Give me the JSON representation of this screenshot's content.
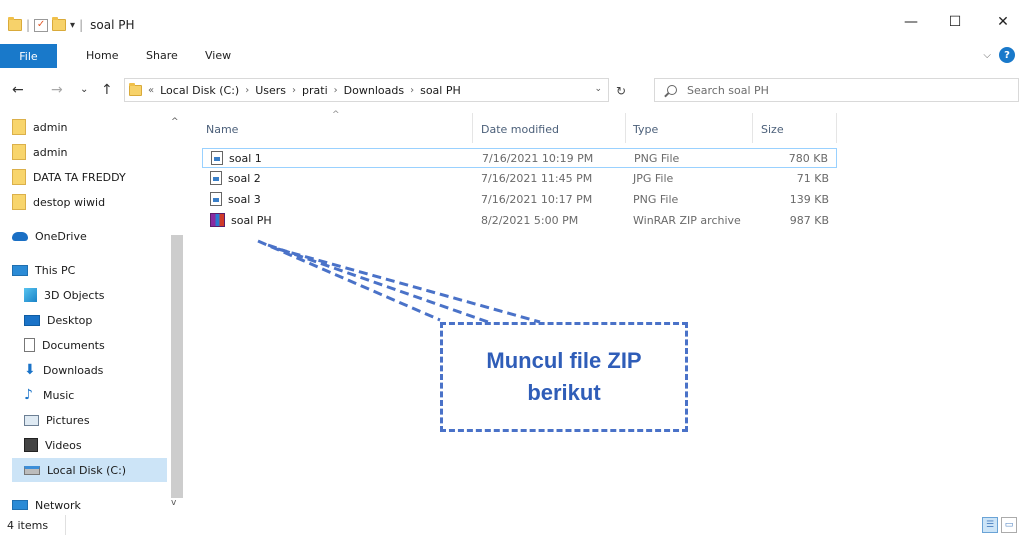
{
  "window": {
    "title": "soal PH",
    "controls": {
      "minimize": "—",
      "maximize": "☐",
      "close": "✕"
    }
  },
  "ribbon": {
    "tabs": [
      "File",
      "Home",
      "Share",
      "View"
    ],
    "help": "?",
    "expand": "⌵"
  },
  "nav": {
    "back": "←",
    "forward": "→",
    "recent": "⌄",
    "up": "↑"
  },
  "address": {
    "overflow": "«",
    "crumbs": [
      "Local Disk (C:)",
      "Users",
      "prati",
      "Downloads",
      "soal PH"
    ],
    "sep": "›",
    "dropdown": "⌄",
    "refresh": "↻"
  },
  "search": {
    "placeholder": "Search soal PH"
  },
  "sidebar": {
    "items": [
      {
        "label": "admin",
        "icon": "folder-icon"
      },
      {
        "label": "admin",
        "icon": "folder-icon"
      },
      {
        "label": "DATA TA FREDDY",
        "icon": "folder-icon"
      },
      {
        "label": "destop wiwid",
        "icon": "folder-icon"
      },
      {
        "label": "OneDrive",
        "icon": "cloud-icon"
      },
      {
        "label": "This PC",
        "icon": "computer-icon"
      },
      {
        "label": "3D Objects",
        "icon": "cube-icon"
      },
      {
        "label": "Desktop",
        "icon": "desktop-icon"
      },
      {
        "label": "Documents",
        "icon": "document-icon"
      },
      {
        "label": "Downloads",
        "icon": "download-icon"
      },
      {
        "label": "Music",
        "icon": "music-icon"
      },
      {
        "label": "Pictures",
        "icon": "picture-icon"
      },
      {
        "label": "Videos",
        "icon": "video-icon"
      },
      {
        "label": "Local Disk (C:)",
        "icon": "disk-icon",
        "selected": true
      },
      {
        "label": "Network",
        "icon": "network-icon"
      }
    ],
    "scroll_up": "^",
    "scroll_down": "v"
  },
  "files": {
    "columns": {
      "name": "Name",
      "date": "Date modified",
      "type": "Type",
      "size": "Size"
    },
    "sort_indicator": "^",
    "rows": [
      {
        "name": "soal 1",
        "date": "7/16/2021 10:19 PM",
        "type": "PNG File",
        "size": "780 KB",
        "icon": "image-file-icon"
      },
      {
        "name": "soal 2",
        "date": "7/16/2021 11:45 PM",
        "type": "JPG File",
        "size": "71 KB",
        "icon": "image-file-icon"
      },
      {
        "name": "soal 3",
        "date": "7/16/2021 10:17 PM",
        "type": "PNG File",
        "size": "139 KB",
        "icon": "image-file-icon"
      },
      {
        "name": "soal PH",
        "date": "8/2/2021 5:00 PM",
        "type": "WinRAR ZIP archive",
        "size": "987 KB",
        "icon": "winrar-archive-icon"
      }
    ]
  },
  "annotation": {
    "line1": "Muncul file ZIP",
    "line2": "berikut",
    "color": "#2f5db8"
  },
  "status": {
    "count": "4 items"
  },
  "colors": {
    "accent": "#1979ca",
    "selection": "#cce4f7"
  }
}
